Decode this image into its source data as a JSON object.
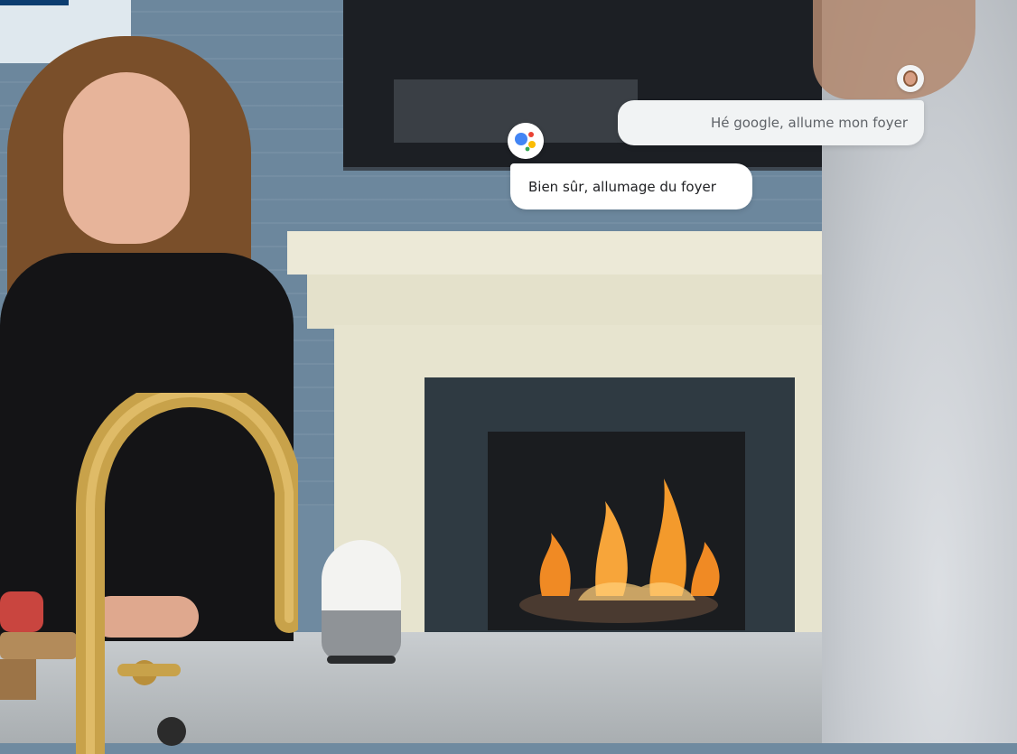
{
  "conversation": {
    "user_message": "Hé google, allume mon foyer",
    "assistant_message": "Bien sûr, allumage du foyer"
  },
  "icons": {
    "assistant": "google-assistant-icon",
    "user": "user-avatar-icon"
  },
  "colors": {
    "assistant_blue": "#4285F4",
    "assistant_red": "#EA4335",
    "assistant_yellow": "#FBBC05",
    "assistant_green": "#34A853",
    "bubble_bg": "#F1F3F4"
  }
}
